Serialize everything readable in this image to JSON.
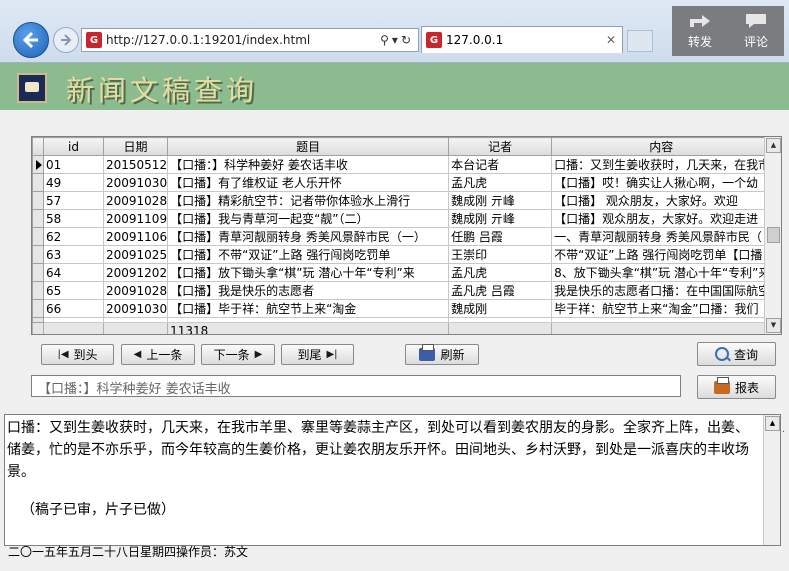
{
  "browser": {
    "url": "http://127.0.0.1:19201/index.html",
    "tab_title": "127.0.0.1",
    "favicon_text": "G",
    "share_label": "转发",
    "comment_label": "评论"
  },
  "app": {
    "title": "新闻文稿查询"
  },
  "grid": {
    "columns": [
      "id",
      "日期",
      "题目",
      "记者",
      "内容"
    ],
    "rows": [
      {
        "id": "01",
        "date": "20150512",
        "title": "【口播：】科学种姜好   姜农话丰收",
        "reporter": "本台记者",
        "content": "口播：又到生姜收获时，几天来，在我市"
      },
      {
        "id": "49",
        "date": "20091030",
        "title": "【口播】有了维权证  老人乐开怀",
        "reporter": "孟凡虎",
        "content": " 【口播】哎！确实让人揪心啊，一个幼"
      },
      {
        "id": "57",
        "date": "20091028",
        "title": "【口播】精彩航空节：记者带你体验水上滑行",
        "reporter": "魏成刚  亓峰",
        "content": " 【口播】     观众朋友，大家好。欢迎"
      },
      {
        "id": "58",
        "date": "20091109",
        "title": "【口播】我与青草河一起变“靓”（二）",
        "reporter": "魏成刚  亓峰",
        "content": "【口播】观众朋友，大家好。欢迎走进"
      },
      {
        "id": "62",
        "date": "20091106",
        "title": "【口播】青草河靓丽转身  秀美风景醉市民（一）",
        "reporter": "任鹏  吕霞",
        "content": "一、青草河靓丽转身  秀美风景醉市民（"
      },
      {
        "id": "63",
        "date": "20091025",
        "title": "【口播】不带“双证”上路   强行闯岗吃罚单",
        "reporter": "王崇印",
        "content": "不带“双证”上路   强行闯岗吃罚单【口播"
      },
      {
        "id": "64",
        "date": "20091202",
        "title": "【口播】放下锄头拿“棋”玩  潜心十年“专利”来",
        "reporter": "孟凡虎",
        "content": "8、放下锄头拿“棋”玩  潜心十年“专利”来"
      },
      {
        "id": "65",
        "date": "20091028",
        "title": "【口播】我是快乐的志愿者",
        "reporter": "孟凡虎  吕霞",
        "content": "我是快乐的志愿者口播：在中国国际航空"
      },
      {
        "id": "66",
        "date": "20091030",
        "title": "【口播】毕于祥：航空节上来“淘金",
        "reporter": "魏成刚",
        "content": "  毕于祥：航空节上来“淘金”口播：我们"
      }
    ],
    "footer_count": "11318"
  },
  "toolbar": {
    "first": "到头",
    "prev": "上一条",
    "next": "下一条",
    "last": "到尾",
    "refresh": "刷新",
    "query": "查询",
    "report": "报表"
  },
  "detail": {
    "title_value": "【口播：】科学种姜好  姜农话丰收",
    "content_lines": [
      "口播：又到生姜收获时，几天来，在我市羊里、寨里等姜蒜主产区，到处可以看到姜农朋友的身影。全家齐上阵，出姜、储姜，忙的是不亦乐乎，而今年较高的生姜价格，更让姜农朋友乐开怀。田间地头、乡村沃野，到处是一派喜庆的丰收场景。",
      "（稿子已审，片子已做）"
    ]
  },
  "status": {
    "text": "二〇一五年五月二十八日星期四操作员：苏文"
  }
}
